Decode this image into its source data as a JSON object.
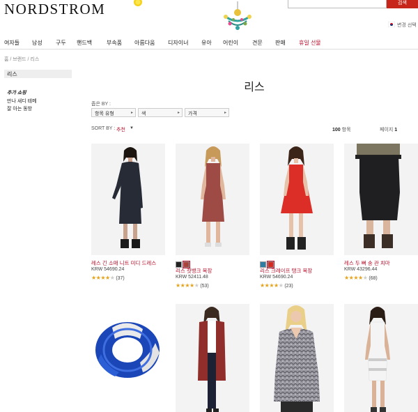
{
  "header": {
    "logo": "NORDSTROM",
    "search_button": "검색",
    "lang_link": "변경 선택"
  },
  "nav": [
    {
      "label": "여자들",
      "sale": false
    },
    {
      "label": "남성",
      "sale": false
    },
    {
      "label": "구두",
      "sale": false
    },
    {
      "label": "핸드백",
      "sale": false
    },
    {
      "label": "부속품",
      "sale": false
    },
    {
      "label": "아름다움",
      "sale": false
    },
    {
      "label": "디자이너",
      "sale": false
    },
    {
      "label": "유아",
      "sale": false
    },
    {
      "label": "어린이",
      "sale": false
    },
    {
      "label": "견문",
      "sale": false
    },
    {
      "label": "판매",
      "sale": false
    },
    {
      "label": "휴일 선물",
      "sale": true
    }
  ],
  "breadcrumb": "홈  /  브랜드  /  리스",
  "sidebar": {
    "active": "리스",
    "heading": "추가 쇼핑",
    "links": [
      "만나 새디 테메",
      "잘 아는 동방"
    ]
  },
  "page_title": "리스",
  "filters": {
    "label": "좁은 BY :",
    "items": [
      "항목 유형",
      "색",
      "가격"
    ]
  },
  "sort": {
    "label": "SORT BY :",
    "value": "추천"
  },
  "count": {
    "number": "100",
    "unit": "항목"
  },
  "paging": {
    "label": "페이지",
    "number": "1"
  },
  "products": [
    {
      "name": "레스 긴 소매 니트 미디 드레스",
      "price": "KRW 54690.24",
      "rating": 4.0,
      "reviews": "(37)",
      "swatches": []
    },
    {
      "name": "리스 컷뱅크 복장",
      "price": "KRW 52411.48",
      "rating": 4.0,
      "reviews": "(53)",
      "swatches": [
        "#222222",
        "#a8423a"
      ]
    },
    {
      "name": "리스 크레이프 탱크 복장",
      "price": "KRW 54690.24",
      "rating": 4.0,
      "reviews": "(23)",
      "swatches": [
        "#2e7ea3",
        "#d12b22"
      ]
    },
    {
      "name": "레스 두 뻐 송 관 치마",
      "price": "KRW 43296.44",
      "rating": 4.5,
      "reviews": "(68)",
      "swatches": []
    }
  ]
}
